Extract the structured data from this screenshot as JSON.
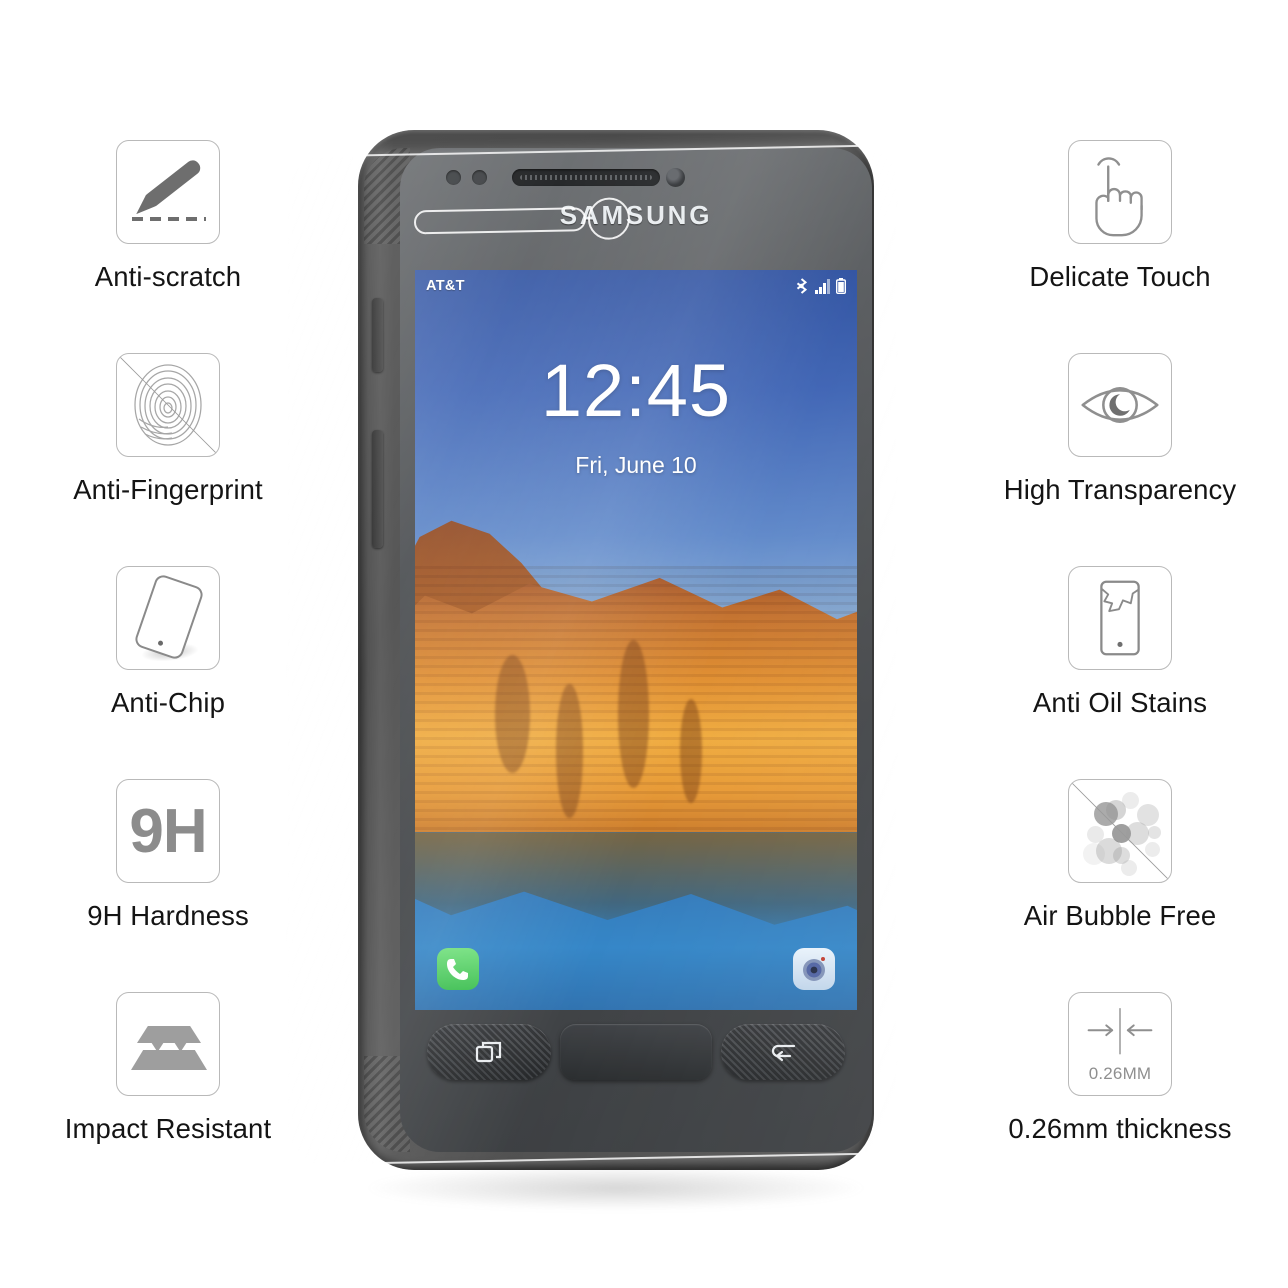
{
  "product": {
    "type": "tempered-glass-screen-protector-infographic",
    "device_brand": "SAMSUNG"
  },
  "features_left": [
    {
      "label": "Anti-scratch",
      "icon": "knife-scratch-icon"
    },
    {
      "label": "Anti-Fingerprint",
      "icon": "fingerprint-icon"
    },
    {
      "label": "Anti-Chip",
      "icon": "tilted-phone-icon"
    },
    {
      "label": "9H Hardness",
      "icon": "hardness-9h-icon",
      "icon_text": "9H"
    },
    {
      "label": "Impact Resistant",
      "icon": "impact-layers-icon"
    }
  ],
  "features_right": [
    {
      "label": "Delicate Touch",
      "icon": "pointing-hand-icon"
    },
    {
      "label": "High Transparency",
      "icon": "eye-icon"
    },
    {
      "label": "Anti Oil Stains",
      "icon": "phone-oil-smudge-icon"
    },
    {
      "label": "Air Bubble Free",
      "icon": "bubbles-slashed-icon"
    },
    {
      "label": "0.26mm thickness",
      "icon": "thickness-caliper-icon",
      "icon_text": "0.26MM"
    }
  ],
  "phone": {
    "brand_text": "SAMSUNG",
    "status_bar": {
      "carrier": "AT&T",
      "icons": [
        "bluetooth-sync-icon",
        "signal-bars-icon",
        "battery-icon"
      ]
    },
    "lockscreen": {
      "time": "12:45",
      "date": "Fri, June 10"
    },
    "apps": [
      {
        "name": "phone-app-icon"
      },
      {
        "name": "camera-app-icon"
      }
    ],
    "nav_keys": [
      {
        "name": "recents-key",
        "glyph": "recents-icon"
      },
      {
        "name": "home-key",
        "glyph": "home-icon"
      },
      {
        "name": "back-key",
        "glyph": "back-icon"
      }
    ]
  },
  "colors": {
    "background": "#ffffff",
    "icon_border": "#b9b9b9",
    "label_text": "#141414",
    "icon_gray": "#8c8c8c",
    "phone_body": "#4b4b4b",
    "screen_blue": "#3d63b4",
    "rock_orange": "#e08f2e",
    "water_blue": "#2f76b8"
  }
}
